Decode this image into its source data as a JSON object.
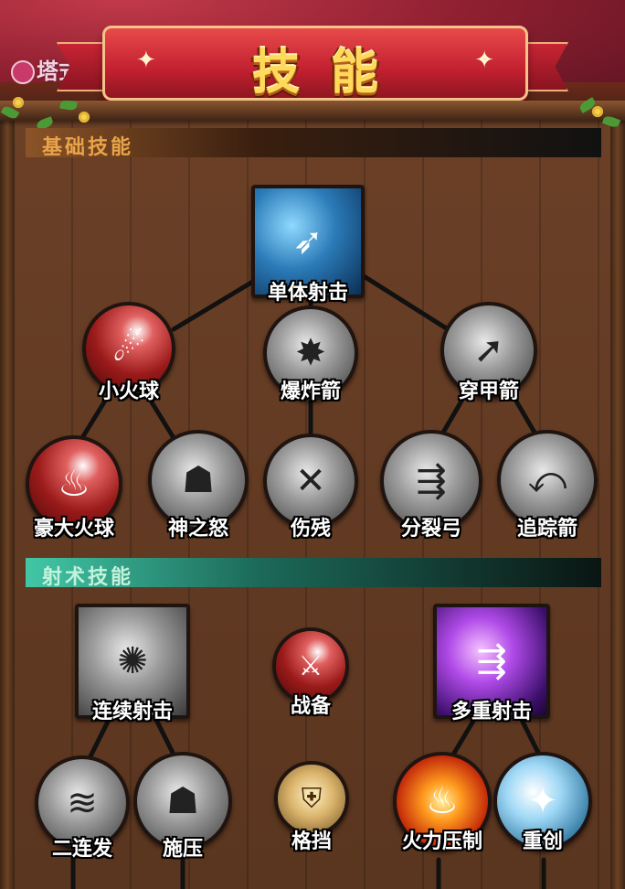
{
  "header": {
    "title": "技能",
    "logo_text": "塔式作战"
  },
  "sections": {
    "basic": {
      "label": "基础技能"
    },
    "archery": {
      "label": "射术技能"
    }
  },
  "skills": {
    "single_shot": {
      "name": "单体射击",
      "icon": "arrow-volley-icon"
    },
    "small_fireball": {
      "name": "小火球",
      "icon": "fireball-icon"
    },
    "explosive_arrow": {
      "name": "爆炸箭",
      "icon": "bow-explosion-icon"
    },
    "piercing_arrow": {
      "name": "穿甲箭",
      "icon": "piercing-arrow-icon"
    },
    "big_fireball": {
      "name": "豪大火球",
      "icon": "flames-icon"
    },
    "wrath_of_god": {
      "name": "神之怒",
      "icon": "wrath-helmet-icon"
    },
    "cripple": {
      "name": "伤残",
      "icon": "cripple-arrow-icon"
    },
    "split_bow": {
      "name": "分裂弓",
      "icon": "split-arrows-icon"
    },
    "tracking_arrow": {
      "name": "追踪箭",
      "icon": "tracking-arrow-icon"
    },
    "rapid_shot": {
      "name": "连续射击",
      "icon": "rapid-shot-icon"
    },
    "battle_ready": {
      "name": "战备",
      "icon": "sword-shield-icon"
    },
    "multi_shot": {
      "name": "多重射击",
      "icon": "multi-arrow-icon"
    },
    "double_shot": {
      "name": "二连发",
      "icon": "double-slash-icon"
    },
    "pressure": {
      "name": "施压",
      "icon": "shadow-figure-icon"
    },
    "block": {
      "name": "格挡",
      "icon": "armor-icon"
    },
    "suppressing_fire": {
      "name": "火力压制",
      "icon": "fire-pillar-icon"
    },
    "heavy_wound": {
      "name": "重创",
      "icon": "heavy-strike-icon"
    }
  }
}
